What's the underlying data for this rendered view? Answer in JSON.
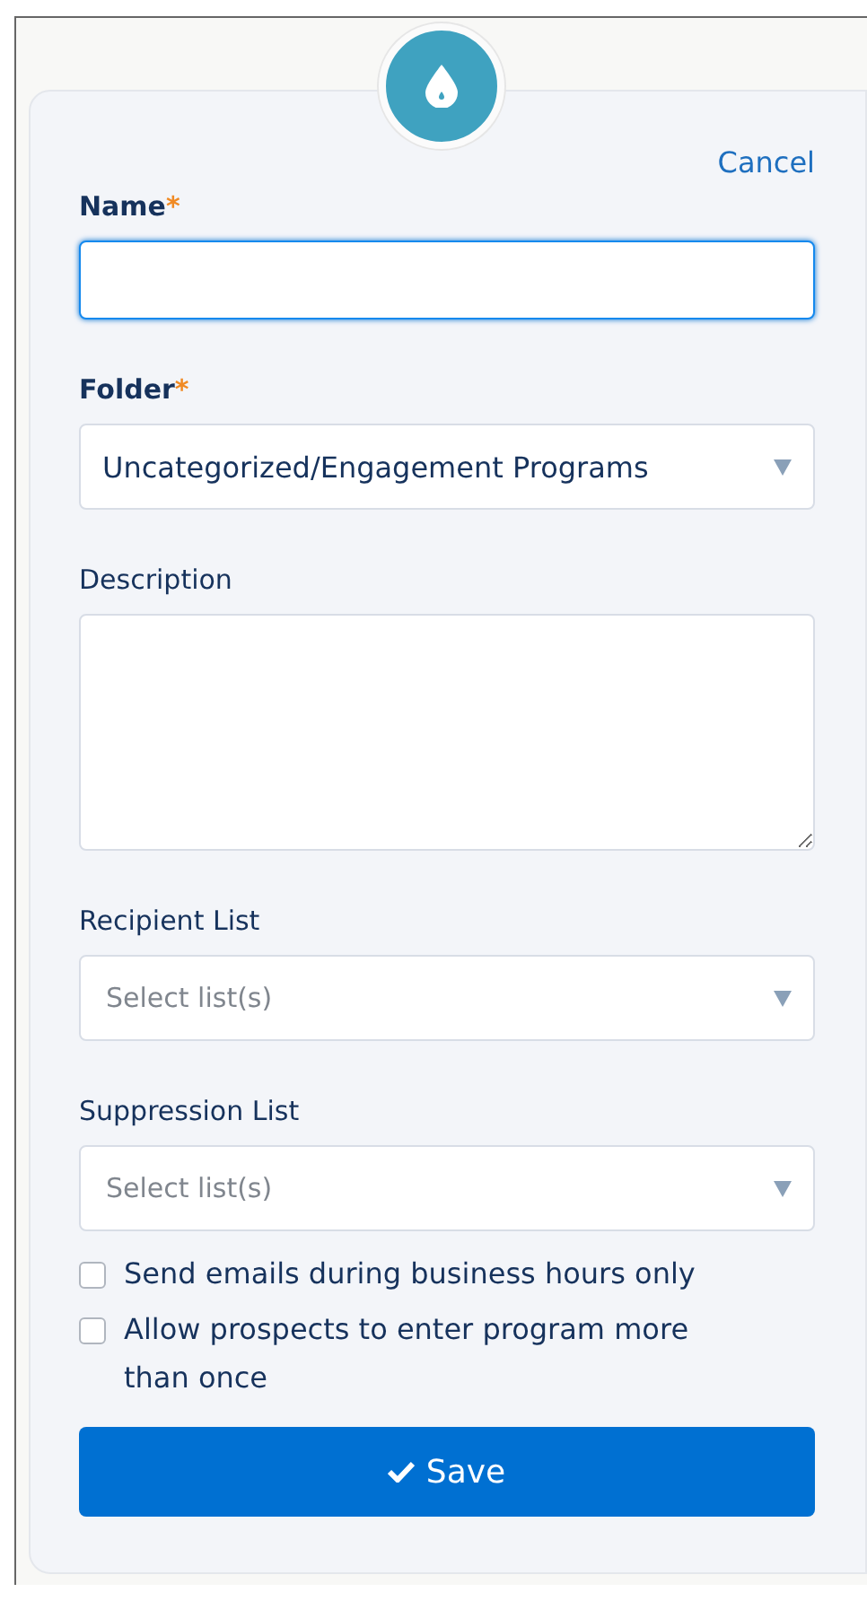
{
  "header": {
    "cancel": "Cancel"
  },
  "fields": [
    {
      "kind": "text",
      "label": "Name",
      "required": true,
      "required_mark": "*",
      "focused": true
    },
    {
      "kind": "select",
      "label": "Folder",
      "required": true,
      "required_mark": "*",
      "focused": false,
      "value": "Uncategorized/Engagement Programs"
    },
    {
      "kind": "textarea",
      "label": "Description",
      "required": false,
      "focused": false
    },
    {
      "kind": "select",
      "label": "Recipient List",
      "required": false,
      "focused": false,
      "placeholder": "Select list(s)"
    },
    {
      "kind": "select",
      "label": "Suppression List",
      "required": false,
      "focused": false,
      "placeholder": "Select list(s)"
    }
  ],
  "options": [
    {
      "label": "Send emails during business hours only",
      "checked": false
    },
    {
      "label": "Allow prospects to enter program more than once",
      "checked": false
    }
  ],
  "save_button": "Save"
}
